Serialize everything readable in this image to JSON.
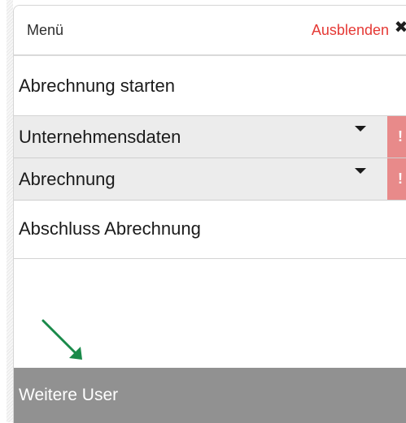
{
  "header": {
    "title": "Menü",
    "hide_label": "Ausblenden",
    "close_glyph": "✖"
  },
  "menu": {
    "items": [
      {
        "label": "Abrechnung starten"
      },
      {
        "label": "Unternehmensdaten",
        "alert": "!"
      },
      {
        "label": "Abrechnung",
        "alert": "!"
      },
      {
        "label": "Abschluss Abrechnung"
      }
    ]
  },
  "footer": {
    "label": "Weitere User"
  },
  "colors": {
    "accent_red": "#e53935",
    "alert_bg": "#e88a8a",
    "footer_bg": "#919191",
    "arrow": "#1a8a4a"
  },
  "icons": {
    "close": "close-icon",
    "dropdown": "caret-down-icon",
    "alert": "alert-icon",
    "pointer": "green-arrow-icon"
  }
}
